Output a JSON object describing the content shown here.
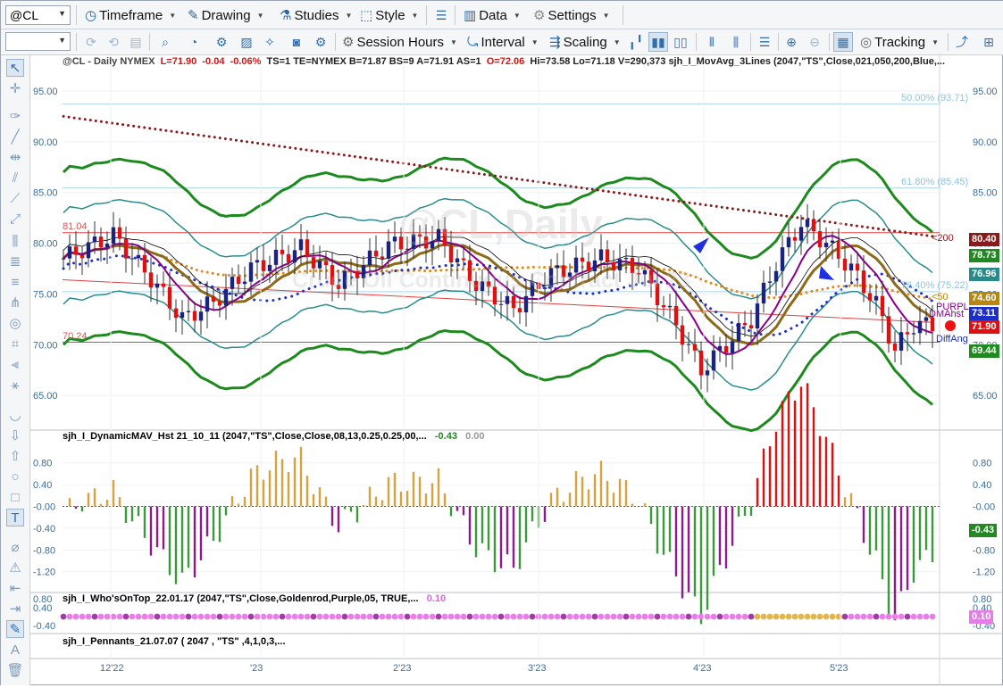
{
  "toolbar1": {
    "symbol": "@CL",
    "timeframe": "Timeframe",
    "drawing": "Drawing",
    "studies": "Studies",
    "style": "Style",
    "data": "Data",
    "settings": "Settings"
  },
  "toolbar2": {
    "session_hours": "Session Hours",
    "interval": "Interval",
    "scaling": "Scaling",
    "tracking": "Tracking"
  },
  "header": {
    "symbol_line": "@CL - Daily  NYMEX",
    "last": "L=71.90",
    "chg": "-0.04",
    "pct": "-0.06%",
    "misc": "TS=1  TE=NYMEX  B=71.87  BS=9  A=71.91  AS=1",
    "open": "O=72.06",
    "rest": "Hi=73.58  Lo=71.18  V=290,373  sjh_I_MovAvg_3Lines (2047,\"TS\",Close,021,050,200,Blue,..."
  },
  "watermark": {
    "title": "@CL,Daily",
    "subtitle": "Crude Oil Continuous Contract Jul 23"
  },
  "price_axis": [
    "95.00",
    "90.00",
    "85.00",
    "80.00",
    "75.00",
    "70.00",
    "65.00"
  ],
  "fib": {
    "f50": "50.00% (93.71)",
    "f618": "61.80% (85.45)",
    "f764": "76.40% (75.22)"
  },
  "levels": {
    "upper": "81.04",
    "lower": "70.24"
  },
  "right_labels": {
    "ma200": "<200",
    "ma50": "<50",
    "purpl": "PURPL",
    "dmahst": "DMAhst",
    "diffang": "DiffAng"
  },
  "price_tags": [
    {
      "value": "80.40",
      "color": "#8b1a1a"
    },
    {
      "value": "78.73",
      "color": "#1f8a1f"
    },
    {
      "value": "76.96",
      "color": "#2a8a8a"
    },
    {
      "value": "74.60",
      "color": "#b8860b"
    },
    {
      "value": "73.11",
      "color": "#1d2fc7"
    },
    {
      "value": "71.90",
      "color": "#e01010"
    },
    {
      "value": "69.44",
      "color": "#1f8a1f"
    }
  ],
  "panel2": {
    "title": "sjh_I_DynamicMAV_Hst 21_10_11 (2047,\"TS\",Close,Close,08,13,0.25,0.25,00,...",
    "v1": "-0.43",
    "v2": "0.00",
    "axis": [
      "0.80",
      "0.40",
      "-0.00",
      "-0.40",
      "-0.80",
      "-1.20"
    ],
    "tag": "-0.43"
  },
  "panel3": {
    "title": "sjh_I_Who'sOnTop_22.01.17 (2047,\"TS\",Close,Goldenrod,Purple,05, TRUE,...",
    "v1": "0.10",
    "axis": [
      "0.80",
      "0.40",
      "-0.40"
    ],
    "tag": "0.10"
  },
  "panel4": {
    "title": "sjh_I_Pennants_21.07.07 ( 2047 , \"TS\" ,4,1,0,3,..."
  },
  "x_axis": [
    "12'22",
    "'23",
    "2'23",
    "3'23",
    "4'23",
    "5'23"
  ]
}
